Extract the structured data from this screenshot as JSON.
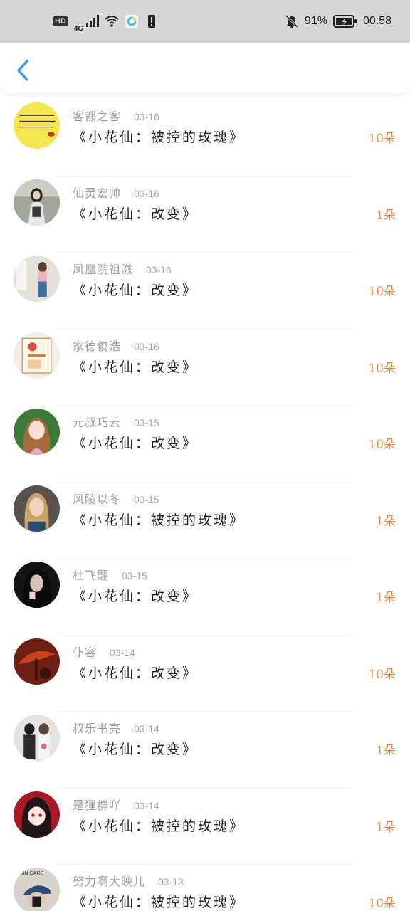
{
  "status_bar": {
    "hd": "HD",
    "network": "4G",
    "battery": "91%",
    "time": "00:58"
  },
  "header": {
    "back_icon": "chevron-left-icon",
    "accent": "#2f9bea"
  },
  "colors": {
    "amount": "#e58a4a",
    "meta": "#9a9a9a"
  },
  "records": [
    {
      "user": "客都之客",
      "date": "03-16",
      "gift": "《小花仙：被控的玫瑰》",
      "amount": "10朵",
      "avatar": "yellow-note"
    },
    {
      "user": "仙灵宏帅",
      "date": "03-16",
      "gift": "《小花仙：改变》",
      "amount": "1朵",
      "avatar": "girl-coat"
    },
    {
      "user": "凤凰院祖滋",
      "date": "03-16",
      "gift": "《小花仙：改变》",
      "amount": "10朵",
      "avatar": "girl-room"
    },
    {
      "user": "家德俊浩",
      "date": "03-16",
      "gift": "《小花仙：改变》",
      "amount": "10朵",
      "avatar": "cartoon-card"
    },
    {
      "user": "元叔巧云",
      "date": "03-15",
      "gift": "《小花仙：改变》",
      "amount": "10朵",
      "avatar": "anime-girl"
    },
    {
      "user": "风陵以冬",
      "date": "03-15",
      "gift": "《小花仙：被控的玫瑰》",
      "amount": "1朵",
      "avatar": "blonde-girl"
    },
    {
      "user": "杜飞翻",
      "date": "03-15",
      "gift": "《小花仙：改变》",
      "amount": "1朵",
      "avatar": "dark-portrait"
    },
    {
      "user": "仆容",
      "date": "03-14",
      "gift": "《小花仙：改变》",
      "amount": "10朵",
      "avatar": "red-umbrella"
    },
    {
      "user": "叔乐书亮",
      "date": "03-14",
      "gift": "《小花仙：改变》",
      "amount": "1朵",
      "avatar": "couple"
    },
    {
      "user": "是狸群吖",
      "date": "03-14",
      "gift": "《小花仙：被控的玫瑰》",
      "amount": "1朵",
      "avatar": "anime-red"
    },
    {
      "user": "努力啊大映儿",
      "date": "03-13",
      "gift": "《小花仙：被控的玫瑰》",
      "amount": "10朵",
      "avatar": "cap-boy",
      "avatar_text": "SKIN CARE"
    }
  ]
}
